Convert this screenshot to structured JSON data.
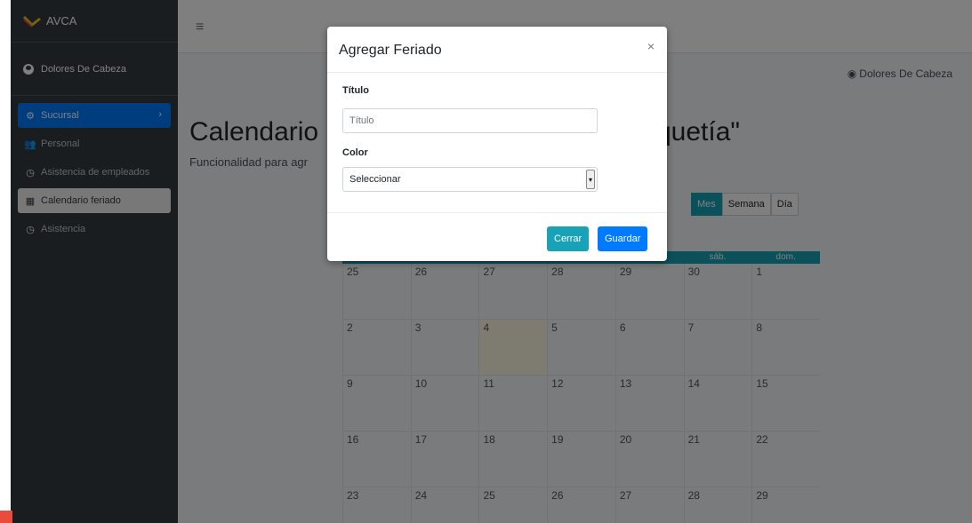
{
  "brand": {
    "name": "AVCA",
    "logo_icon": "avca-logo-icon"
  },
  "sidebar": {
    "user": "Dolores De Cabeza",
    "items": [
      {
        "label": "Sucursal",
        "icon": "cogs-icon"
      },
      {
        "label": "Personal",
        "icon": "users-icon"
      },
      {
        "label": "Asistencia de empleados",
        "icon": "clock-icon"
      },
      {
        "label": "Calendario feriado",
        "icon": "calendar-icon"
      },
      {
        "label": "Asistencia",
        "icon": "clock-icon"
      }
    ]
  },
  "topbar": {
    "user": "Dolores De Cabeza"
  },
  "page": {
    "title_left": "Calendario",
    "title_right": "quetía\"",
    "subtitle": "Funcionalidad para agr"
  },
  "calendar": {
    "views": [
      "Mes",
      "Semana",
      "Día"
    ],
    "header": [
      "",
      "",
      "",
      "",
      "",
      "sáb.",
      "dom."
    ],
    "weeks": [
      [
        "25",
        "26",
        "27",
        "28",
        "29",
        "30",
        "1"
      ],
      [
        "2",
        "3",
        "4",
        "5",
        "6",
        "7",
        "8"
      ],
      [
        "9",
        "10",
        "11",
        "12",
        "13",
        "14",
        "15"
      ],
      [
        "16",
        "17",
        "18",
        "19",
        "20",
        "21",
        "22"
      ],
      [
        "23",
        "24",
        "25",
        "26",
        "27",
        "28",
        "29"
      ]
    ]
  },
  "modal": {
    "title": "Agregar Feriado",
    "close": "×",
    "title_label": "Título",
    "title_placeholder": "Título",
    "color_label": "Color",
    "color_value": "Seleccionar",
    "cancel": "Cerrar",
    "save": "Guardar"
  },
  "colors": {
    "sidebar": "#343a40",
    "primary": "#007bff",
    "info": "#17a2b8"
  }
}
